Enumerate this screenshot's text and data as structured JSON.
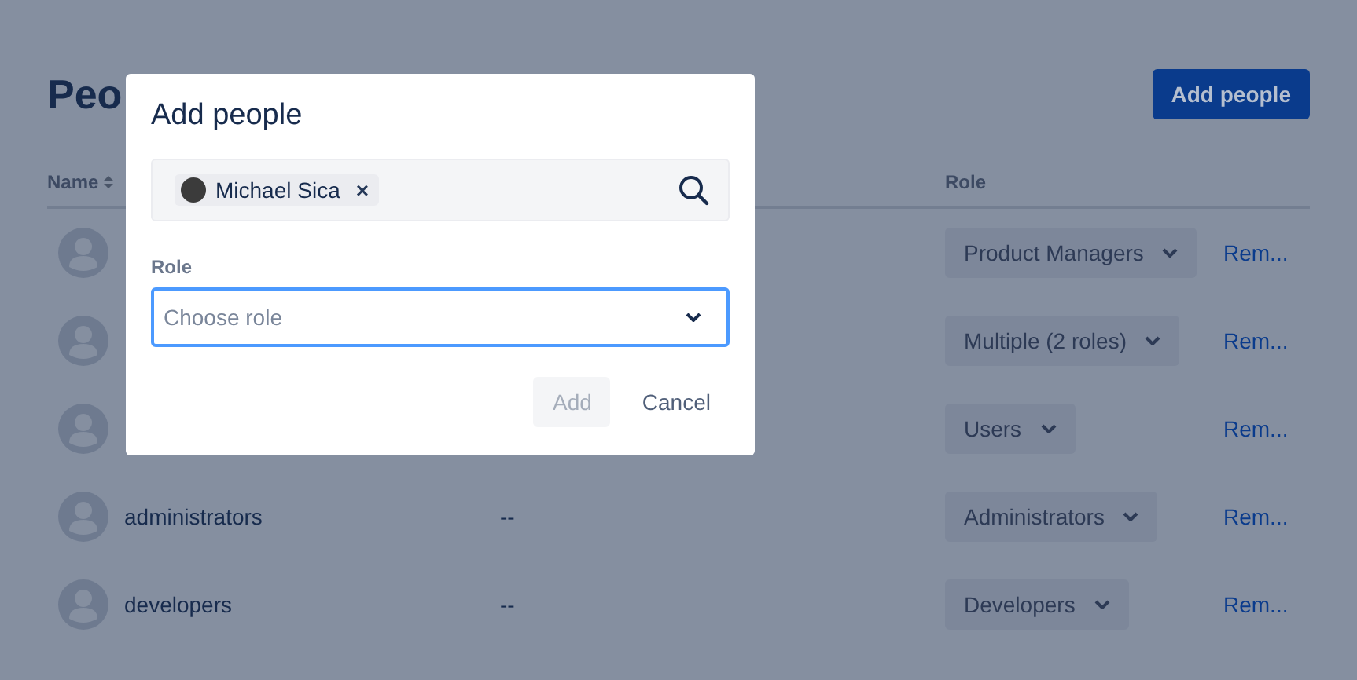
{
  "page": {
    "title": "Peo",
    "add_button": "Add people"
  },
  "table": {
    "columns": [
      {
        "label": "Name",
        "sortable": true
      },
      {
        "label": "Role",
        "sortable": false
      }
    ],
    "rows": [
      {
        "role": "Product Managers",
        "action": "Rem..."
      },
      {
        "role": "Multiple (2 roles)",
        "action": "Rem..."
      },
      {
        "role": "Users",
        "action": "Rem..."
      },
      {
        "name": "administrators",
        "email": "--",
        "role": "Administrators",
        "action": "Rem..."
      },
      {
        "name": "developers",
        "email": "--",
        "role": "Developers",
        "action": "Rem..."
      }
    ]
  },
  "modal": {
    "title": "Add people",
    "picker": {
      "tokens": [
        {
          "name": "Michael Sica",
          "remove": "×"
        }
      ]
    },
    "role_field": {
      "label": "Role",
      "placeholder": "Choose role",
      "focused": true
    },
    "buttons": [
      {
        "label": "Add",
        "kind": "primary",
        "disabled": true
      },
      {
        "label": "Cancel",
        "kind": "subtle",
        "disabled": false
      }
    ]
  }
}
